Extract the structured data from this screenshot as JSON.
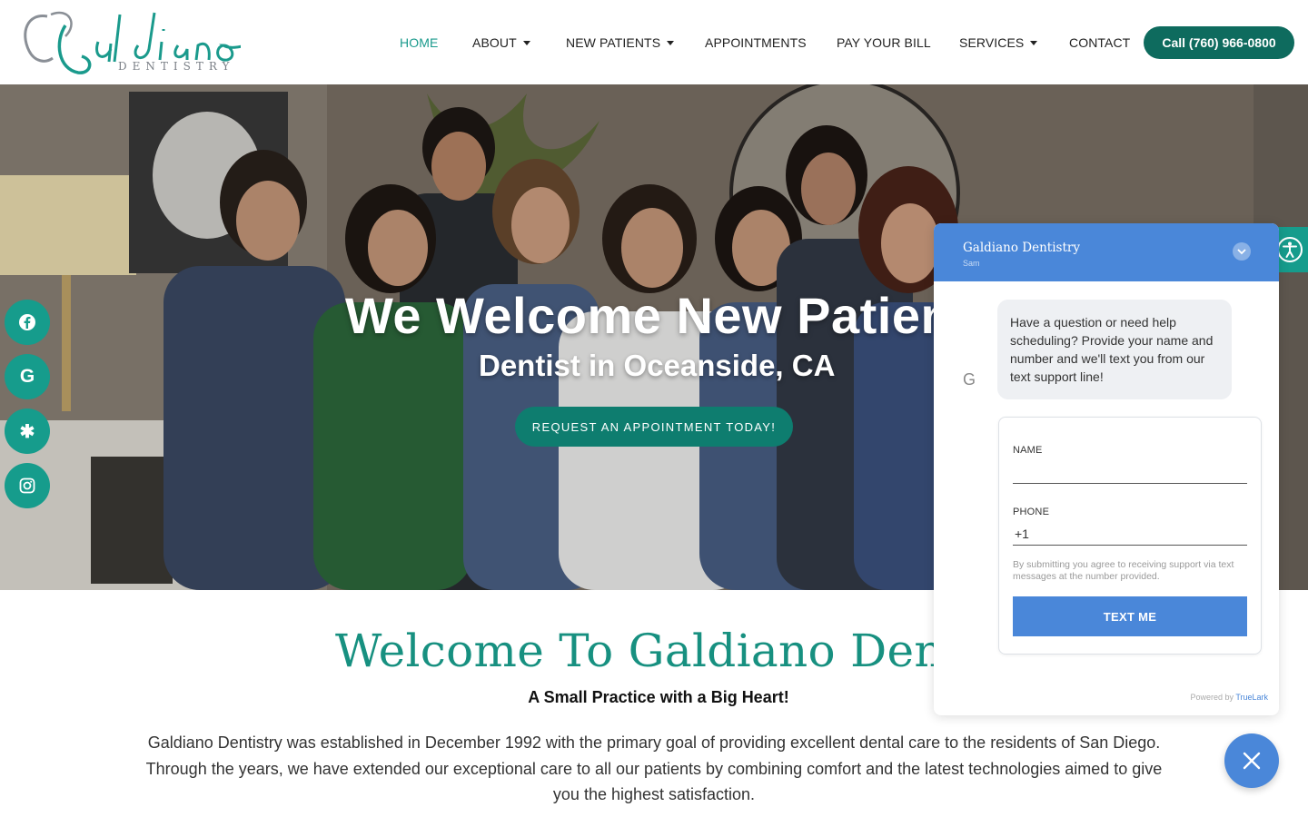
{
  "brand": {
    "logo_text": "Galdiano",
    "logo_sub": "DENTISTRY",
    "accent": "#169c8c",
    "dark_accent": "#0e6b5e"
  },
  "nav": {
    "items": [
      {
        "label": "HOME",
        "active": true,
        "dropdown": false
      },
      {
        "label": "ABOUT",
        "active": false,
        "dropdown": true
      },
      {
        "label": "NEW PATIENTS",
        "active": false,
        "dropdown": true
      },
      {
        "label": "APPOINTMENTS",
        "active": false,
        "dropdown": false
      },
      {
        "label": "PAY YOUR BILL",
        "active": false,
        "dropdown": false
      },
      {
        "label": "SERVICES",
        "active": false,
        "dropdown": true
      },
      {
        "label": "CONTACT",
        "active": false,
        "dropdown": false
      }
    ],
    "call_label": "Call (760) 966-0800"
  },
  "hero": {
    "title": "We Welcome New Patients",
    "subtitle": "Dentist in Oceanside, CA",
    "cta": "REQUEST AN APPOINTMENT TODAY!"
  },
  "social": [
    {
      "icon": "facebook-icon",
      "glyph": "f"
    },
    {
      "icon": "google-icon",
      "glyph": "G"
    },
    {
      "icon": "yelp-icon",
      "glyph": "✱"
    },
    {
      "icon": "instagram-icon",
      "glyph": "◎"
    }
  ],
  "welcome": {
    "title": "Welcome To Galdiano Dentistry",
    "subtitle": "A Small Practice with a Big Heart!",
    "paragraph": "Galdiano Dentistry was established in December 1992 with the primary goal of providing excellent dental care to the residents of San Diego. Through the years, we have extended our exceptional care to all our patients by combining comfort and the latest technologies aimed to give you the highest satisfaction."
  },
  "chat": {
    "title": "Galdiano Dentistry",
    "agent": "Sam",
    "avatar": "G",
    "message": "Have a question or need help scheduling? Provide your name and number and we'll text you from our text support line!",
    "name_label": "NAME",
    "phone_label": "PHONE",
    "phone_value": "+1",
    "consent": "By submitting you agree to receiving support via text messages at the number provided.",
    "button": "TEXT ME",
    "powered_prefix": "Powered by",
    "powered_brand": "TrueLark",
    "header_color": "#4a87d9"
  }
}
